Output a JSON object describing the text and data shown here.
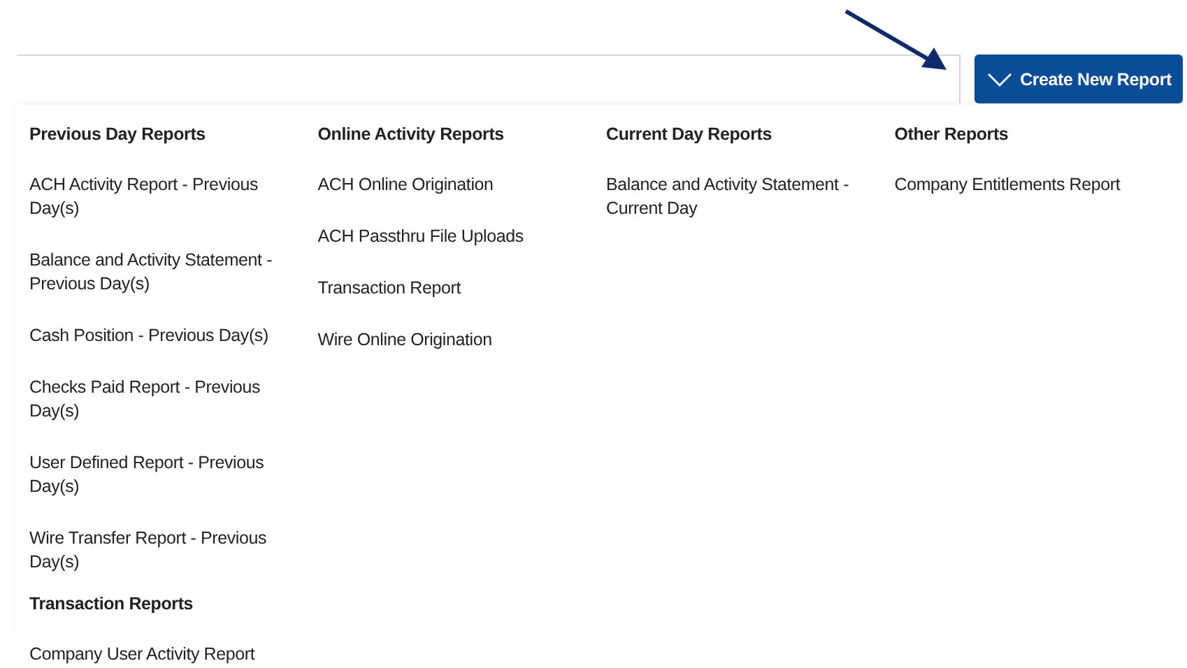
{
  "create_button": {
    "label": "Create New Report"
  },
  "columns": [
    {
      "groups": [
        {
          "heading": "Previous Day Reports",
          "items": [
            "ACH Activity Report - Previous Day(s)",
            "Balance and Activity Statement - Previous Day(s)",
            "Cash Position - Previous Day(s)",
            "Checks Paid Report - Previous Day(s)",
            "User Defined Report - Previous Day(s)",
            "Wire Transfer Report - Previous Day(s)"
          ]
        },
        {
          "heading": "Transaction Reports",
          "items": [
            "Company User Activity Report"
          ]
        }
      ]
    },
    {
      "groups": [
        {
          "heading": "Online Activity Reports",
          "items": [
            "ACH Online Origination",
            "ACH Passthru File Uploads",
            "Transaction Report",
            "Wire Online Origination"
          ]
        }
      ]
    },
    {
      "groups": [
        {
          "heading": "Current Day Reports",
          "items": [
            "Balance and Activity Statement - Current Day"
          ]
        }
      ]
    },
    {
      "groups": [
        {
          "heading": "Other Reports",
          "items": [
            "Company Entitlements Report"
          ]
        }
      ]
    }
  ]
}
